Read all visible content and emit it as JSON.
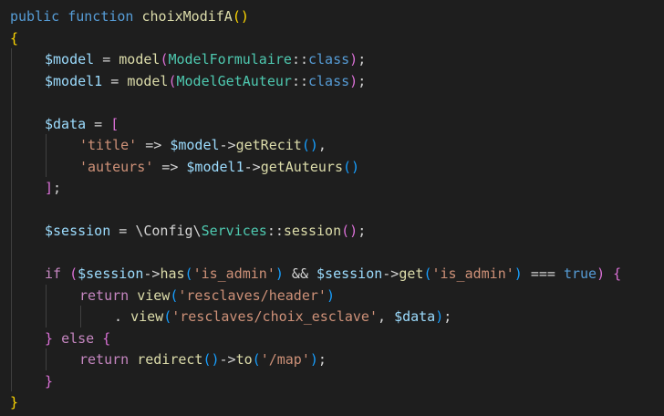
{
  "editor": {
    "colors": {
      "background": "#1e1e1e",
      "indent_guide": "#404040",
      "keyword": "#569cd6",
      "function": "#dcdcaa",
      "variable": "#9cdcfe",
      "class": "#4ec9b0",
      "string": "#ce9178",
      "control": "#c586c0",
      "plain": "#d4d4d4",
      "bracket_level1": "#ffd700",
      "bracket_level2": "#da70d6",
      "bracket_level3": "#179fff"
    },
    "lines": [
      {
        "indent": 0,
        "tokens": [
          {
            "t": "public",
            "c": "keyword"
          },
          {
            "t": " ",
            "c": "plain"
          },
          {
            "t": "function",
            "c": "keyword"
          },
          {
            "t": " ",
            "c": "plain"
          },
          {
            "t": "choixModifA",
            "c": "function"
          },
          {
            "t": "()",
            "c": "bracket_level1"
          }
        ]
      },
      {
        "indent": 0,
        "tokens": [
          {
            "t": "{",
            "c": "bracket_level1"
          }
        ]
      },
      {
        "indent": 1,
        "tokens": [
          {
            "t": "$model",
            "c": "variable"
          },
          {
            "t": " = ",
            "c": "plain"
          },
          {
            "t": "model",
            "c": "function"
          },
          {
            "t": "(",
            "c": "bracket_level2"
          },
          {
            "t": "ModelFormulaire",
            "c": "class"
          },
          {
            "t": "::",
            "c": "plain"
          },
          {
            "t": "class",
            "c": "keyword"
          },
          {
            "t": ")",
            "c": "bracket_level2"
          },
          {
            "t": ";",
            "c": "plain"
          }
        ]
      },
      {
        "indent": 1,
        "tokens": [
          {
            "t": "$model1",
            "c": "variable"
          },
          {
            "t": " = ",
            "c": "plain"
          },
          {
            "t": "model",
            "c": "function"
          },
          {
            "t": "(",
            "c": "bracket_level2"
          },
          {
            "t": "ModelGetAuteur",
            "c": "class"
          },
          {
            "t": "::",
            "c": "plain"
          },
          {
            "t": "class",
            "c": "keyword"
          },
          {
            "t": ")",
            "c": "bracket_level2"
          },
          {
            "t": ";",
            "c": "plain"
          }
        ]
      },
      {
        "indent": 0,
        "tokens": []
      },
      {
        "indent": 1,
        "tokens": [
          {
            "t": "$data",
            "c": "variable"
          },
          {
            "t": " = ",
            "c": "plain"
          },
          {
            "t": "[",
            "c": "bracket_level2"
          }
        ]
      },
      {
        "indent": 2,
        "tokens": [
          {
            "t": "'title'",
            "c": "string"
          },
          {
            "t": " => ",
            "c": "plain"
          },
          {
            "t": "$model",
            "c": "variable"
          },
          {
            "t": "->",
            "c": "plain"
          },
          {
            "t": "getRecit",
            "c": "function"
          },
          {
            "t": "()",
            "c": "bracket_level3"
          },
          {
            "t": ",",
            "c": "plain"
          }
        ]
      },
      {
        "indent": 2,
        "tokens": [
          {
            "t": "'auteurs'",
            "c": "string"
          },
          {
            "t": " => ",
            "c": "plain"
          },
          {
            "t": "$model1",
            "c": "variable"
          },
          {
            "t": "->",
            "c": "plain"
          },
          {
            "t": "getAuteurs",
            "c": "function"
          },
          {
            "t": "()",
            "c": "bracket_level3"
          }
        ]
      },
      {
        "indent": 1,
        "tokens": [
          {
            "t": "]",
            "c": "bracket_level2"
          },
          {
            "t": ";",
            "c": "plain"
          }
        ]
      },
      {
        "indent": 0,
        "tokens": []
      },
      {
        "indent": 1,
        "tokens": [
          {
            "t": "$session",
            "c": "variable"
          },
          {
            "t": " = \\Config\\",
            "c": "plain"
          },
          {
            "t": "Services",
            "c": "class"
          },
          {
            "t": "::",
            "c": "plain"
          },
          {
            "t": "session",
            "c": "function"
          },
          {
            "t": "()",
            "c": "bracket_level2"
          },
          {
            "t": ";",
            "c": "plain"
          }
        ]
      },
      {
        "indent": 0,
        "tokens": []
      },
      {
        "indent": 1,
        "tokens": [
          {
            "t": "if",
            "c": "control"
          },
          {
            "t": " ",
            "c": "plain"
          },
          {
            "t": "(",
            "c": "bracket_level2"
          },
          {
            "t": "$session",
            "c": "variable"
          },
          {
            "t": "->",
            "c": "plain"
          },
          {
            "t": "has",
            "c": "function"
          },
          {
            "t": "(",
            "c": "bracket_level3"
          },
          {
            "t": "'is_admin'",
            "c": "string"
          },
          {
            "t": ")",
            "c": "bracket_level3"
          },
          {
            "t": " && ",
            "c": "plain"
          },
          {
            "t": "$session",
            "c": "variable"
          },
          {
            "t": "->",
            "c": "plain"
          },
          {
            "t": "get",
            "c": "function"
          },
          {
            "t": "(",
            "c": "bracket_level3"
          },
          {
            "t": "'is_admin'",
            "c": "string"
          },
          {
            "t": ")",
            "c": "bracket_level3"
          },
          {
            "t": " === ",
            "c": "plain"
          },
          {
            "t": "true",
            "c": "keyword"
          },
          {
            "t": ")",
            "c": "bracket_level2"
          },
          {
            "t": " ",
            "c": "plain"
          },
          {
            "t": "{",
            "c": "bracket_level2"
          }
        ]
      },
      {
        "indent": 2,
        "tokens": [
          {
            "t": "return",
            "c": "control"
          },
          {
            "t": " ",
            "c": "plain"
          },
          {
            "t": "view",
            "c": "function"
          },
          {
            "t": "(",
            "c": "bracket_level3"
          },
          {
            "t": "'resclaves/header'",
            "c": "string"
          },
          {
            "t": ")",
            "c": "bracket_level3"
          }
        ]
      },
      {
        "indent": 3,
        "tokens": [
          {
            "t": ". ",
            "c": "plain"
          },
          {
            "t": "view",
            "c": "function"
          },
          {
            "t": "(",
            "c": "bracket_level3"
          },
          {
            "t": "'resclaves/choix_esclave'",
            "c": "string"
          },
          {
            "t": ", ",
            "c": "plain"
          },
          {
            "t": "$data",
            "c": "variable"
          },
          {
            "t": ")",
            "c": "bracket_level3"
          },
          {
            "t": ";",
            "c": "plain"
          }
        ]
      },
      {
        "indent": 1,
        "tokens": [
          {
            "t": "}",
            "c": "bracket_level2"
          },
          {
            "t": " ",
            "c": "plain"
          },
          {
            "t": "else",
            "c": "control"
          },
          {
            "t": " ",
            "c": "plain"
          },
          {
            "t": "{",
            "c": "bracket_level2"
          }
        ]
      },
      {
        "indent": 2,
        "tokens": [
          {
            "t": "return",
            "c": "control"
          },
          {
            "t": " ",
            "c": "plain"
          },
          {
            "t": "redirect",
            "c": "function"
          },
          {
            "t": "()",
            "c": "bracket_level3"
          },
          {
            "t": "->",
            "c": "plain"
          },
          {
            "t": "to",
            "c": "function"
          },
          {
            "t": "(",
            "c": "bracket_level3"
          },
          {
            "t": "'/map'",
            "c": "string"
          },
          {
            "t": ")",
            "c": "bracket_level3"
          },
          {
            "t": ";",
            "c": "plain"
          }
        ]
      },
      {
        "indent": 1,
        "tokens": [
          {
            "t": "}",
            "c": "bracket_level2"
          }
        ]
      },
      {
        "indent": 0,
        "tokens": [
          {
            "t": "}",
            "c": "bracket_level1"
          }
        ]
      }
    ]
  }
}
